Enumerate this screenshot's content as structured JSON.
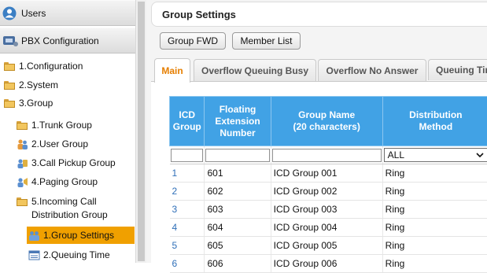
{
  "sidebar": {
    "users_label": "Users",
    "pbx_label": "PBX Configuration",
    "tree": [
      {
        "label": "1.Configuration",
        "icon": "folder-icon"
      },
      {
        "label": "2.System",
        "icon": "folder-icon"
      },
      {
        "label": "3.Group",
        "icon": "folder-open-icon"
      },
      {
        "label": "1.Trunk Group",
        "icon": "folder-icon"
      },
      {
        "label": "2.User Group",
        "icon": "user-group-icon"
      },
      {
        "label": "3.Call Pickup Group",
        "icon": "call-pickup-icon"
      },
      {
        "label": "4.Paging Group",
        "icon": "paging-icon"
      },
      {
        "label": "5.Incoming Call",
        "label2": "Distribution Group",
        "icon": "folder-open-icon"
      },
      {
        "label": "1.Group Settings",
        "icon": "group-settings-icon"
      },
      {
        "label": "2.Queuing Time",
        "icon": "queuing-time-icon"
      }
    ]
  },
  "page": {
    "title": "Group Settings",
    "buttons": {
      "group_fwd": "Group FWD",
      "member_list": "Member List"
    },
    "tabs": [
      "Main",
      "Overflow Queuing Busy",
      "Overflow No Answer",
      "Queuing Time"
    ]
  },
  "table": {
    "headers": {
      "icd_group": [
        "ICD",
        "Group"
      ],
      "floating_ext": [
        "Floating",
        "Extension",
        "Number"
      ],
      "group_name": [
        "Group Name",
        "(20 characters)"
      ],
      "distribution": [
        "Distribution",
        "Method"
      ]
    },
    "filter": {
      "distribution_selected": "ALL"
    },
    "rows": [
      {
        "icd": "1",
        "ext": "601",
        "name": "ICD Group 001",
        "method": "Ring"
      },
      {
        "icd": "2",
        "ext": "602",
        "name": "ICD Group 002",
        "method": "Ring"
      },
      {
        "icd": "3",
        "ext": "603",
        "name": "ICD Group 003",
        "method": "Ring"
      },
      {
        "icd": "4",
        "ext": "604",
        "name": "ICD Group 004",
        "method": "Ring"
      },
      {
        "icd": "5",
        "ext": "605",
        "name": "ICD Group 005",
        "method": "Ring"
      },
      {
        "icd": "6",
        "ext": "606",
        "name": "ICD Group 006",
        "method": "Ring"
      }
    ]
  },
  "colors": {
    "accent": "#f0a000",
    "header_blue": "#41a2e5",
    "active_tab_text": "#e67e00"
  }
}
